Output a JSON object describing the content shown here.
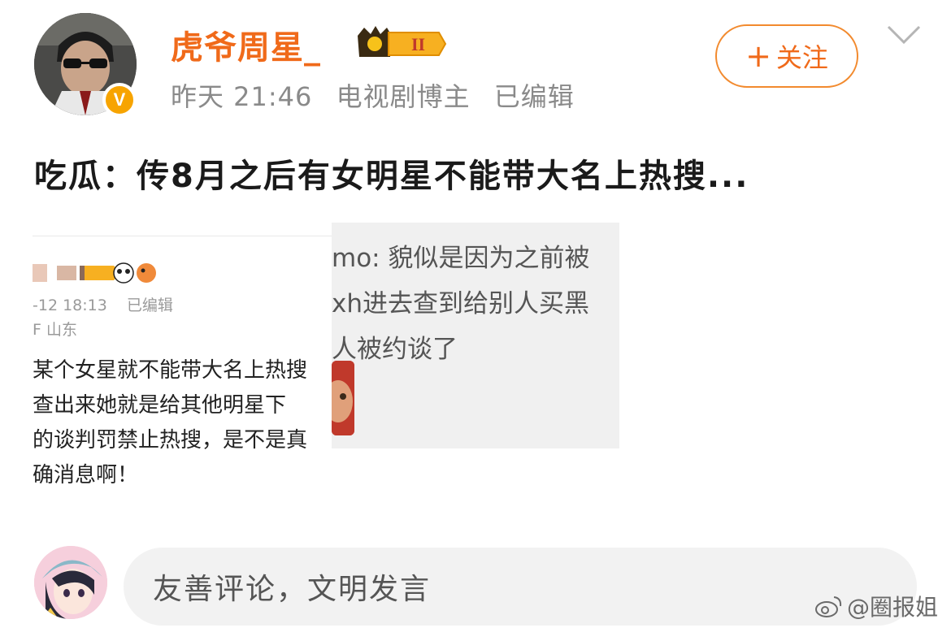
{
  "post": {
    "username": "虎爷周星_",
    "time": "昨天 21:46",
    "author_tag": "电视剧博主",
    "edited": "已编辑",
    "follow_label": "关注",
    "text": "吃瓜：传8月之后有女明星不能带大名上热搜..."
  },
  "image_left": {
    "time": "-12 18:13",
    "edited": "已编辑",
    "location": "F 山东",
    "lines": [
      "某个女星就不能带大名上热搜",
      " 查出来她就是给其他明星下",
      "的谈判罚禁止热搜，是不是真",
      "确消息啊！"
    ]
  },
  "image_right": {
    "lines": [
      "mo: 貌似是因为之前被",
      "xh进去查到给别人买黑",
      "人被约谈了"
    ]
  },
  "comment": {
    "placeholder": "友善评论，文明发言"
  },
  "watermark": {
    "text": "@圈报姐"
  },
  "colors": {
    "accent": "#f06a1a",
    "follow_border": "#f28a2e",
    "vip_badge": "#f7a400"
  }
}
